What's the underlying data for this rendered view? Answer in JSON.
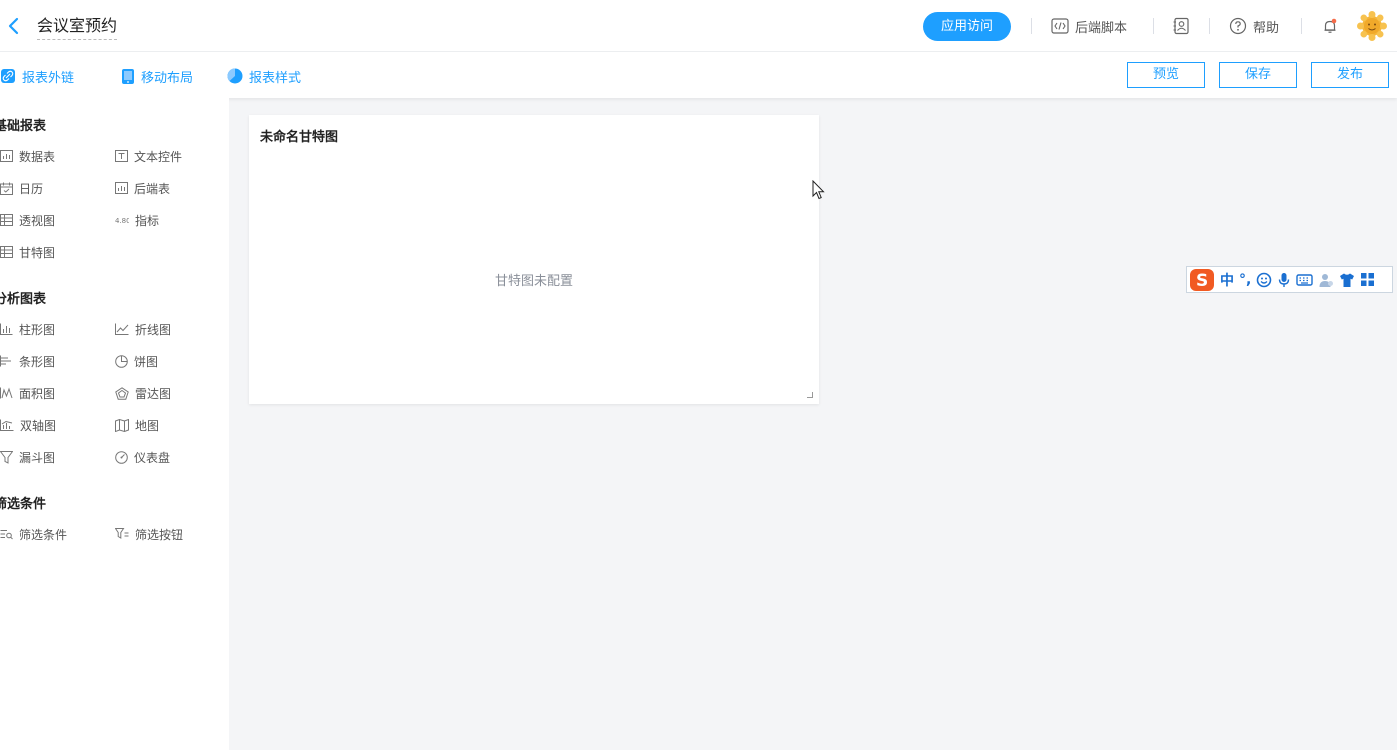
{
  "header": {
    "title": "会议室预约",
    "visit_button": "应用访问",
    "backend_script": "后端脚本",
    "help": "帮助"
  },
  "toolbar": {
    "links": [
      "报表外链",
      "移动布局",
      "报表样式"
    ],
    "preview": "预览",
    "save": "保存",
    "publish": "发布"
  },
  "sidebar": {
    "groups": [
      {
        "title": "基础报表",
        "items": [
          "数据表",
          "文本控件",
          "日历",
          "后端表",
          "透视图",
          "指标",
          "甘特图"
        ]
      },
      {
        "title": "分析图表",
        "items": [
          "柱形图",
          "折线图",
          "条形图",
          "饼图",
          "面积图",
          "雷达图",
          "双轴图",
          "地图",
          "漏斗图",
          "仪表盘"
        ]
      },
      {
        "title": "筛选条件",
        "items": [
          "筛选条件",
          "筛选按钮"
        ]
      }
    ]
  },
  "canvas": {
    "card_title": "未命名甘特图",
    "empty_text": "甘特图未配置"
  },
  "ime": {
    "mode": "中",
    "punct": "°,"
  },
  "colors": {
    "accent": "#1e9fff",
    "sidebar_bg": "#ffffff",
    "canvas_bg": "#f4f5f7"
  }
}
